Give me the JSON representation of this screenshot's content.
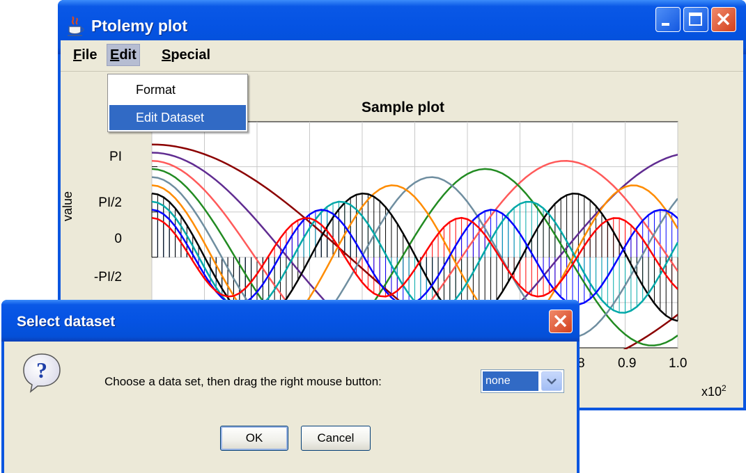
{
  "main_window": {
    "title": "Ptolemy plot",
    "app_icon": "java-cup-icon",
    "controls": [
      "minimize-icon",
      "maximize-icon",
      "close-icon"
    ]
  },
  "menubar": {
    "file": {
      "mnemonic": "F",
      "rest": "ile"
    },
    "edit": {
      "mnemonic": "E",
      "rest": "dit"
    },
    "special": {
      "mnemonic": "S",
      "rest": "pecial"
    }
  },
  "edit_menu": {
    "items": [
      {
        "label": "Format"
      },
      {
        "label": "Edit Dataset",
        "highlighted": true
      }
    ]
  },
  "plot": {
    "title": "Sample plot",
    "ylabel": "value",
    "y_ticks": [
      "PI",
      "PI/2",
      "0",
      "-PI/2"
    ],
    "x_ticks": [
      "8",
      "0.9",
      "1.0"
    ],
    "x_scale_base": "x10",
    "x_scale_exp": "2"
  },
  "chart_data": {
    "type": "line",
    "title": "Sample plot",
    "ylabel": "value",
    "xlabel": "",
    "x_multiplier": "x10^2",
    "xlim": [
      0.0,
      1.0
    ],
    "ylim": [
      -3.14,
      4.7
    ],
    "grid": true,
    "series_colors": [
      "#ff0000",
      "#0000ff",
      "#00a8a8",
      "#000000",
      "#ff8c00",
      "#6f8ea0",
      "#228b22",
      "#ff5a5a",
      "#602c91",
      "#8b0000"
    ]
  },
  "dialog": {
    "title": "Select dataset",
    "icon": "question-icon",
    "message": "Choose a data set, then drag the right mouse button:",
    "combo_value": "none",
    "ok_label": "OK",
    "cancel_label": "Cancel"
  }
}
